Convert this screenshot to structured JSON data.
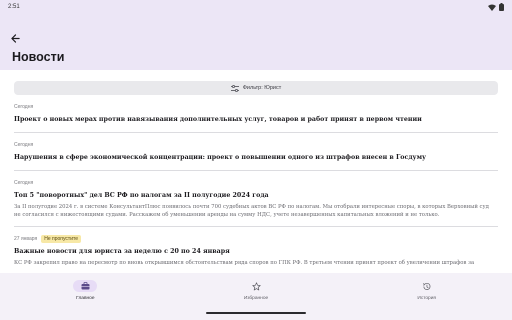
{
  "status_bar": {
    "time": "2:51"
  },
  "app_bar": {
    "title": "Новости"
  },
  "filter": {
    "label": "Фильтр: Юрист"
  },
  "news": [
    {
      "date": "Сегодня",
      "badge": "",
      "title": "Проект о новых мерах против навязывания дополнительных услуг, товаров и работ принят в первом чтении",
      "text": ""
    },
    {
      "date": "Сегодня",
      "badge": "",
      "title": "Нарушения в сфере экономической концентрации: проект о повышении одного из штрафов внесен в Госдуму",
      "text": ""
    },
    {
      "date": "Сегодня",
      "badge": "",
      "title": "Топ 5 \"поворотных\" дел ВС РФ по налогам за II полугодие 2024 года",
      "text": "За II полугодие 2024 г. в системе КонсультантПлюс появилось почти 700 судебных актов ВС РФ по налогам. Мы отобрали интересные споры, в которых Верховный суд не согласился с нижестоящими судами. Расскажем об уменьшении аренды на сумму НДС, учете незавершенных капитальных вложений и не только."
    },
    {
      "date": "27 января",
      "badge": "Не пропустите",
      "title": "Важные новости для юриста за неделю с 20 по 24 января",
      "text": "КС РФ закрепил право на пересмотр по вновь открывшимся обстоятельствам ряда споров по ГПК РФ. В третьем чтении принят проект об увеличении штрафов за"
    }
  ],
  "bottom_nav": [
    {
      "label": "Главное",
      "icon": "briefcase-icon",
      "active": true
    },
    {
      "label": "Избранное",
      "icon": "star-icon",
      "active": false
    },
    {
      "label": "История",
      "icon": "history-icon",
      "active": false
    }
  ],
  "colors": {
    "app_bar_bg": "#ece6f6",
    "badge_bg": "#f7e8a6",
    "nav_active": "#e7dcf6"
  }
}
